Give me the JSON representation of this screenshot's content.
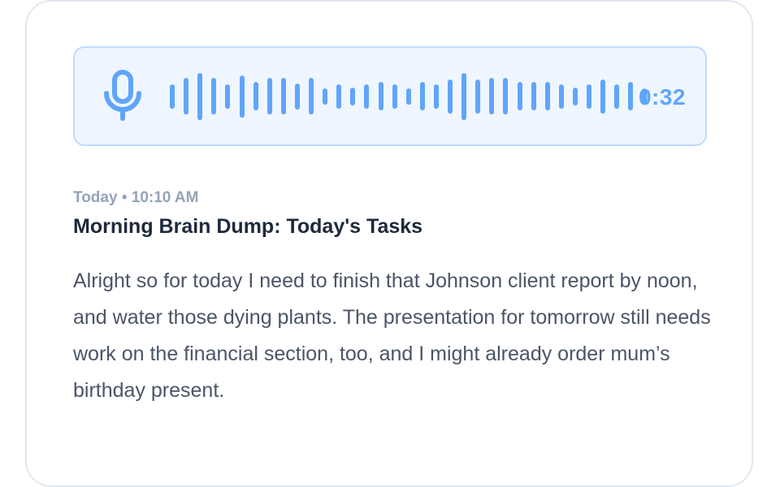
{
  "recording": {
    "duration": "0:32",
    "waveform_levels": [
      0.3,
      0.45,
      0.58,
      0.45,
      0.3,
      0.52,
      0.35,
      0.45,
      0.45,
      0.32,
      0.45,
      0.2,
      0.3,
      0.22,
      0.3,
      0.35,
      0.3,
      0.2,
      0.35,
      0.3,
      0.42,
      0.58,
      0.42,
      0.45,
      0.45,
      0.35,
      0.35,
      0.35,
      0.3,
      0.22,
      0.3,
      0.42,
      0.3,
      0.35,
      0.2
    ]
  },
  "note": {
    "meta": "Today • 10:10 AM",
    "title": "Morning Brain Dump: Today's Tasks",
    "body": "Alright so for today I need to finish that Johnson client report by noon, and water those dying plants. The presentation for tomorrow still needs work on the financial section, too, and I might already order mum’s birthday present."
  },
  "colors": {
    "accent": "#60a5fa",
    "player_bg": "#eff6ff",
    "player_border": "#bfdbfe",
    "title": "#1e293b",
    "meta": "#94a3b8",
    "body": "#4b5567"
  }
}
